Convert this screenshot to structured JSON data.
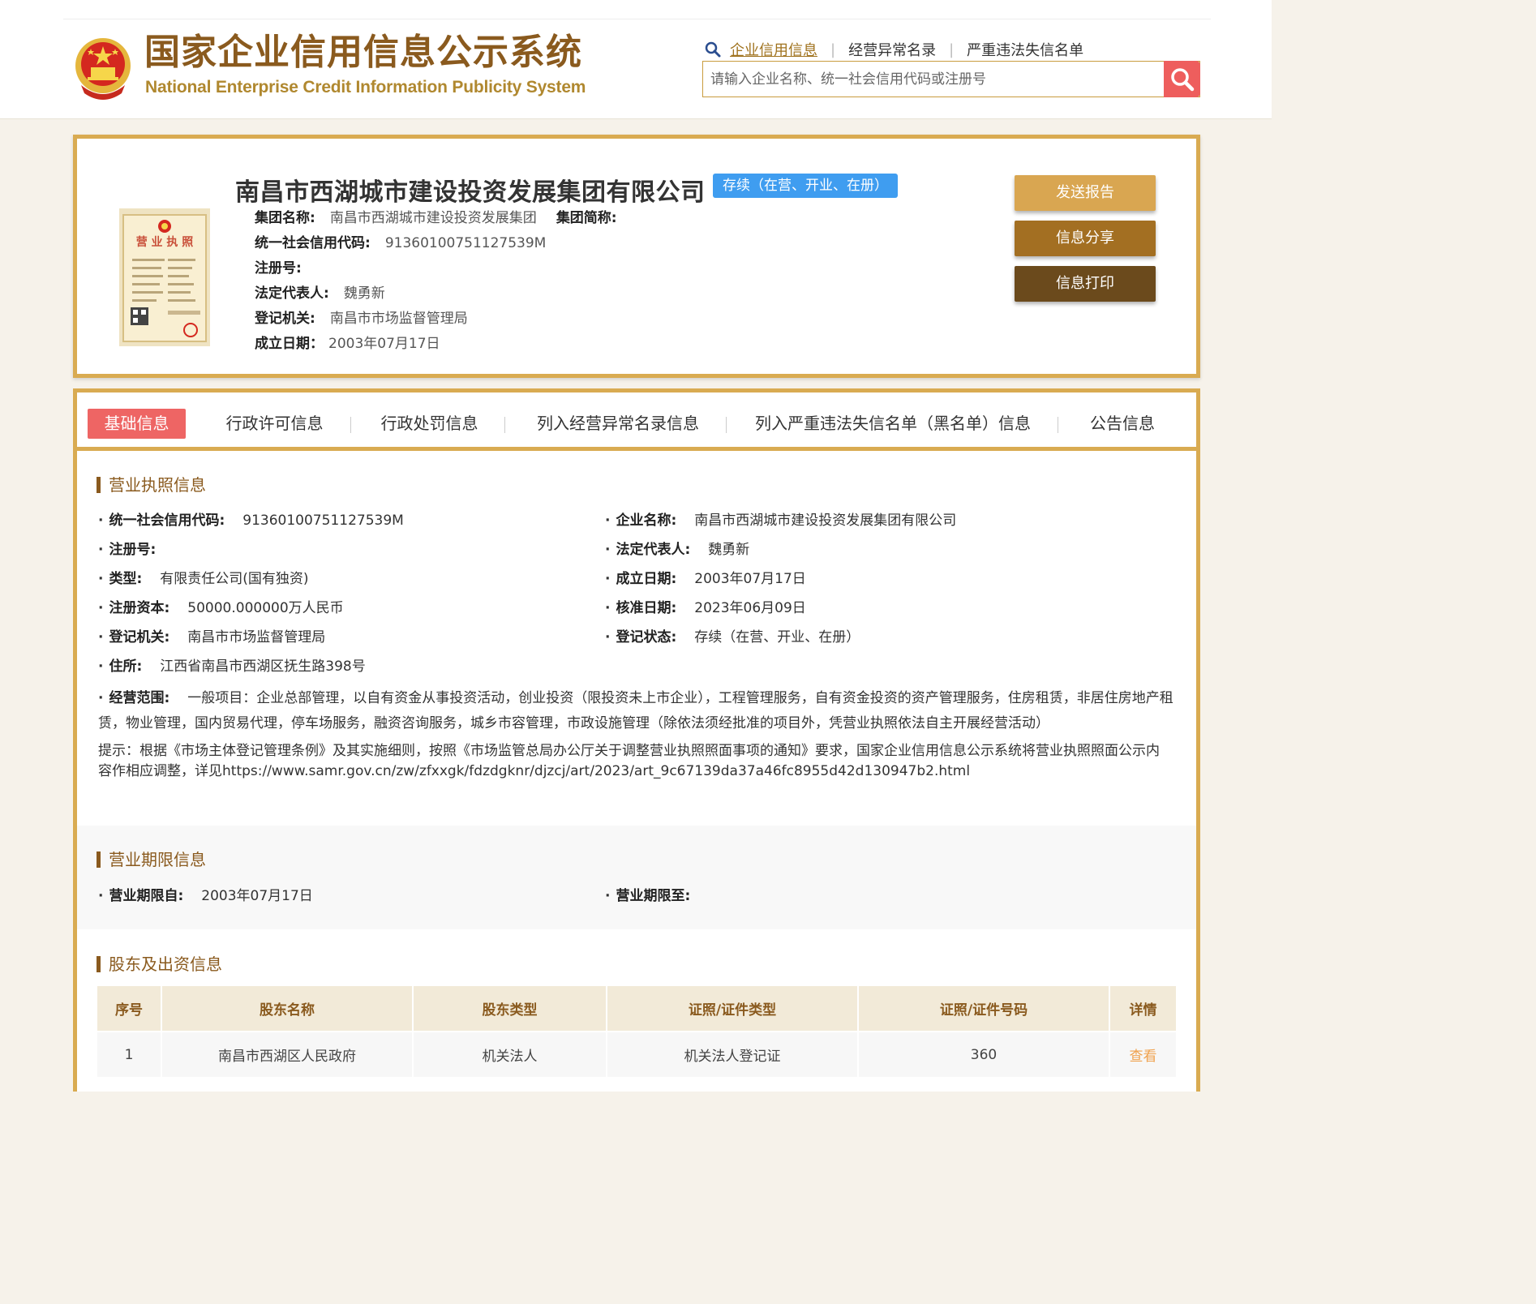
{
  "header": {
    "title_cn": "国家企业信用信息公示系统",
    "title_en": "National Enterprise Credit Information Publicity System",
    "nav": [
      "企业信用信息",
      "经营异常名录",
      "严重违法失信名单"
    ],
    "search_placeholder": "请输入企业名称、统一社会信用代码或注册号"
  },
  "company": {
    "name": "南昌市西湖城市建设投资发展集团有限公司",
    "status": "存续（在营、开业、在册）",
    "group_name_label": "集团名称:",
    "group_name": "南昌市西湖城市建设投资发展集团",
    "group_short_label": "集团简称:",
    "credit_code_label": "统一社会信用代码:",
    "credit_code": "91360100751127539M",
    "reg_no_label": "注册号:",
    "legal_rep_label": "法定代表人:",
    "legal_rep": "魏勇新",
    "reg_authority_label": "登记机关:",
    "reg_authority": "南昌市市场监督管理局",
    "founded_label": "成立日期：",
    "founded": "2003年07月17日",
    "buttons": {
      "send": "发送报告",
      "share": "信息分享",
      "print": "信息打印"
    }
  },
  "tabs": [
    "基础信息",
    "行政许可信息",
    "行政处罚信息",
    "列入经营异常名录信息",
    "列入严重违法失信名单（黑名单）信息",
    "公告信息"
  ],
  "license": {
    "heading": "营业执照信息",
    "credit_code_label": "统一社会信用代码:",
    "credit_code": "91360100751127539M",
    "company_name_label": "企业名称:",
    "company_name": "南昌市西湖城市建设投资发展集团有限公司",
    "reg_no_label": "注册号:",
    "legal_rep_label": "法定代表人:",
    "legal_rep": "魏勇新",
    "type_label": "类型:",
    "type": "有限责任公司(国有独资)",
    "founded_label": "成立日期:",
    "founded": "2003年07月17日",
    "capital_label": "注册资本:",
    "capital": "50000.000000万人民币",
    "approved_label": "核准日期:",
    "approved": "2023年06月09日",
    "authority_label": "登记机关:",
    "authority": "南昌市市场监督管理局",
    "status_label": "登记状态:",
    "status": "存续（在营、开业、在册）",
    "address_label": "住所:",
    "address": "江西省南昌市西湖区抚生路398号",
    "scope_label": "经营范围:",
    "scope": "一般项目：企业总部管理，以自有资金从事投资活动，创业投资（限投资未上市企业），工程管理服务，自有资金投资的资产管理服务，住房租赁，非居住房地产租赁，物业管理，国内贸易代理，停车场服务，融资咨询服务，城乡市容管理，市政设施管理（除依法须经批准的项目外，凭营业执照依法自主开展经营活动）",
    "notice": "提示：根据《市场主体登记管理条例》及其实施细则，按照《市场监管总局办公厅关于调整营业执照照面事项的通知》要求，国家企业信用信息公示系统将营业执照照面公示内容作相应调整，详见https://www.samr.gov.cn/zw/zfxxgk/fdzdgknr/djzcj/art/2023/art_9c67139da37a46fc8955d42d130947b2.html"
  },
  "term": {
    "heading": "营业期限信息",
    "from_label": "营业期限自:",
    "from": "2003年07月17日",
    "to_label": "营业期限至:"
  },
  "shareholders": {
    "heading": "股东及出资信息",
    "columns": [
      "序号",
      "股东名称",
      "股东类型",
      "证照/证件类型",
      "证照/证件号码",
      "详情"
    ],
    "rows": [
      {
        "no": "1",
        "name": "南昌市西湖区人民政府",
        "type": "机关法人",
        "cert_type": "机关法人登记证",
        "cert_no": "360",
        "detail": "查看"
      }
    ]
  }
}
